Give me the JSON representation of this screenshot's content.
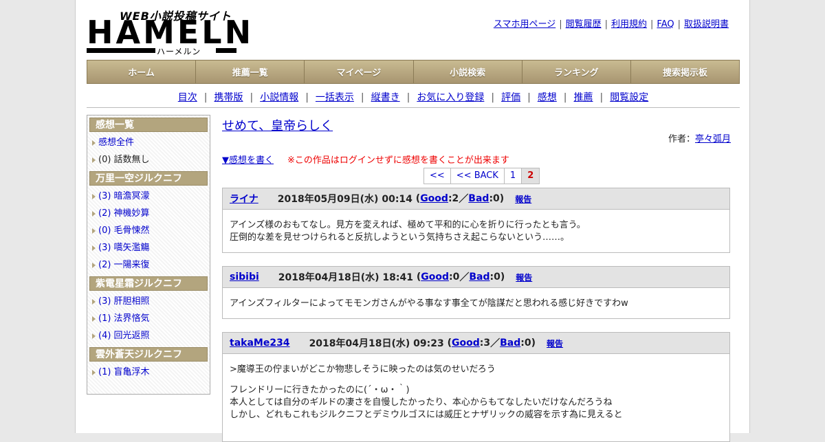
{
  "logo": {
    "tagline": "WEB小説投稿サイト",
    "wordmark": "HAMELN",
    "kana": "ハーメルン"
  },
  "top_links": [
    "スマホ用ページ",
    "閲覧履歴",
    "利用規約",
    "FAQ",
    "取扱説明書"
  ],
  "main_nav": [
    "ホーム",
    "推薦一覧",
    "マイページ",
    "小説検索",
    "ランキング",
    "捜索掲示板"
  ],
  "sub_nav": [
    "目次",
    "携帯版",
    "小説情報",
    "一括表示",
    "縦書き",
    "お気に入り登録",
    "評価",
    "感想",
    "推薦",
    "閲覧設定"
  ],
  "sidebar": {
    "sections": [
      {
        "title": "感想一覧",
        "items": [
          {
            "label": "感想全件",
            "link": true
          },
          {
            "label": "(0) 話数無し",
            "link": false
          }
        ]
      },
      {
        "title": "万里一空ジルクニフ",
        "items": [
          {
            "label": "(3) 暗澹冥濛",
            "link": true
          },
          {
            "label": "(2) 神機妙算",
            "link": true
          },
          {
            "label": "(0) 毛骨悚然",
            "link": true
          },
          {
            "label": "(3) 嚆矢濫觴",
            "link": true
          },
          {
            "label": "(2) 一陽来復",
            "link": true
          }
        ]
      },
      {
        "title": "紫電星霜ジルクニフ",
        "items": [
          {
            "label": "(3) 肝胆相照",
            "link": true
          },
          {
            "label": "(1) 法界悋気",
            "link": true
          },
          {
            "label": "(4) 回光返照",
            "link": true
          }
        ]
      },
      {
        "title": "雲外蒼天ジルクニフ",
        "items": [
          {
            "label": "(1) 盲亀浮木",
            "link": true
          }
        ]
      }
    ]
  },
  "novel": {
    "title": "せめて、皇帝らしく",
    "author_label": "作者：",
    "author": "亭々弧月"
  },
  "write_link": "▼感想を書く",
  "notice": "※この作品はログインせずに感想を書くことが出来ます",
  "pager": {
    "first": "<<",
    "back": "<< BACK",
    "pages": [
      "1",
      "2"
    ],
    "current": "2"
  },
  "reviews": [
    {
      "user": "ライナ",
      "date": "2018年05月09日(水) 00:14",
      "good_label": "Good",
      "good": "2",
      "bad_label": "Bad",
      "bad": "0",
      "report": "報告",
      "lines": [
        "アインズ様のおもてなし。見方を変えれば、極めて平和的に心を折りに行ったとも言う。",
        "圧倒的な差を見せつけられると反抗しようという気持ちさえ起こらないという……。"
      ]
    },
    {
      "user": "sibibi",
      "date": "2018年04月18日(水) 18:41",
      "good_label": "Good",
      "good": "0",
      "bad_label": "Bad",
      "bad": "0",
      "report": "報告",
      "lines": [
        "アインズフィルターによってモモンガさんがやる事なす事全てが陰謀だと思われる感じ好きですわw"
      ]
    },
    {
      "user": "takaMe234",
      "date": "2018年04月18日(水) 09:23",
      "good_label": "Good",
      "good": "3",
      "bad_label": "Bad",
      "bad": "0",
      "report": "報告",
      "lines": [
        ">魔導王の佇まいがどこか物悲しそうに映ったのは気のせいだろう",
        "",
        "フレンドリーに行きたかったのに(´・ω・｀)",
        "本人としては自分のギルドの凄さを自慢したかったり、本心からもてなしたいだけなんだろうね",
        "しかし、どれもこれもジルクニフとデミウルゴスには威圧とナザリックの威容を示す為に見えると"
      ]
    }
  ]
}
